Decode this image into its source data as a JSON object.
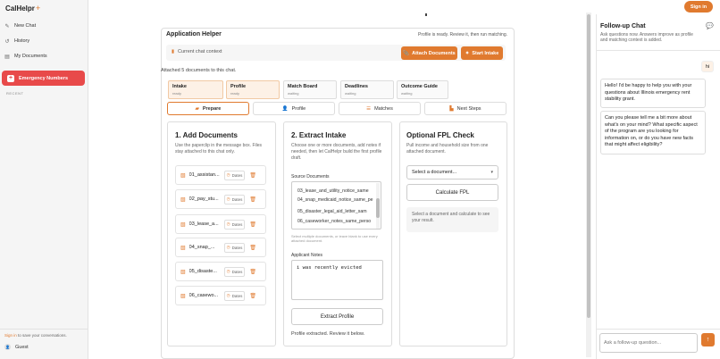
{
  "app": {
    "brand": "CalHelpr",
    "brand_plus": "+"
  },
  "sidebar": {
    "items": [
      {
        "label": "New Chat",
        "icon": "pencil-icon"
      },
      {
        "label": "History",
        "icon": "history-icon"
      },
      {
        "label": "My Documents",
        "icon": "document-icon"
      }
    ],
    "emergency_label": "Emergency Numbers",
    "recent_label": "RECENT",
    "signin_link": "Sign in",
    "signin_rest": " to save your conversations.",
    "guest_label": "Guest"
  },
  "header": {
    "signin_button": "Sign in"
  },
  "helper": {
    "title": "Application Helper",
    "status": "Profile is ready. Review it, then run matching.",
    "context_label": "Current chat context",
    "attach_button": "Attach Documents",
    "start_button": "Start Intake",
    "attached_note": "Attached 5 documents to this chat.",
    "stages": [
      {
        "name": "Intake",
        "status": "ready"
      },
      {
        "name": "Profile",
        "status": "ready"
      },
      {
        "name": "Match Board",
        "status": "waiting"
      },
      {
        "name": "Deadlines",
        "status": "waiting"
      },
      {
        "name": "Outcome Guide",
        "status": "waiting"
      }
    ],
    "tabs": [
      "Prepare",
      "Profile",
      "Matches",
      "Next Steps"
    ]
  },
  "add_documents": {
    "title": "1. Add Documents",
    "desc": "Use the paperclip in the message box. Files stay attached to this chat only.",
    "dates_label": "Dates",
    "docs": [
      "01_assistan...",
      "02_pay_stu...",
      "03_lease_a...",
      "04_snap_...",
      "05_disaste...",
      "06_casewo..."
    ]
  },
  "extract": {
    "title": "2. Extract Intake",
    "desc": "Choose one or more documents, add notes if needed, then let CalHelpr build the first profile draft.",
    "source_label": "Source Documents",
    "sources": [
      "03_lease_and_utility_notice_same",
      "04_snap_medicaid_notice_same_pe",
      "05_disaster_legal_aid_letter_sam",
      "06_caseworker_notes_same_perso"
    ],
    "hint": "Select multiple documents, or leave blank to use every attached document.",
    "notes_label": "Applicant Notes",
    "notes_value": "i was recently evicted",
    "extract_button": "Extract Profile",
    "status": "Profile extracted. Review it below."
  },
  "fpl": {
    "title": "Optional FPL Check",
    "desc": "Pull income and household size from one attached document.",
    "select_value": "Select a document...",
    "calc_button": "Calculate FPL",
    "result": "Select a document and calculate to see your result."
  },
  "followup": {
    "title": "Follow-up Chat",
    "subtitle": "Ask questions now. Answers improve as profile and matching context is added.",
    "user_msg": "hi",
    "bot_msgs": [
      "Hello! I'd be happy to help you with your questions about Illinois emergency rent stability grant.",
      "Can you please tell me a bit more about what's on your mind? What specific aspect of the program are you looking for information on, or do you have new facts that might affect eligibility?"
    ],
    "input_placeholder": "Ask a follow-up question..."
  },
  "colors": {
    "accent": "#e07a2f",
    "emergency": "#e84a4a"
  }
}
